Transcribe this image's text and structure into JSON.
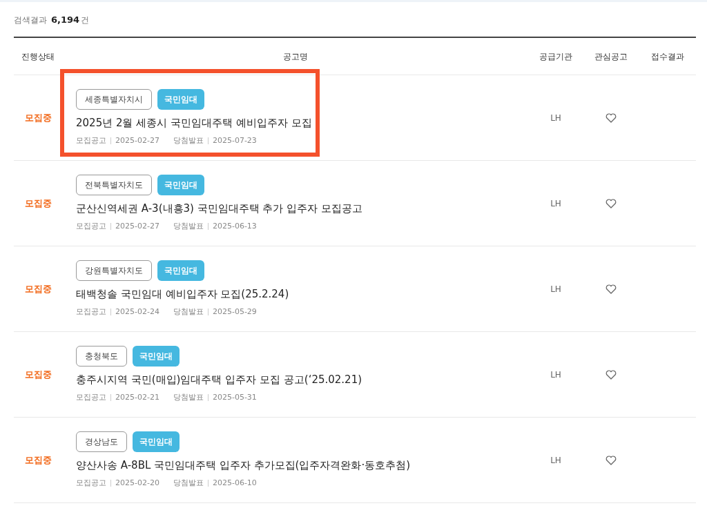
{
  "result_summary": {
    "label": "검색결과",
    "count": "6,194",
    "unit": "건"
  },
  "table": {
    "columns": [
      "진행상태",
      "공고명",
      "공급기관",
      "관심공고",
      "접수결과"
    ],
    "rows": [
      {
        "status": "모집중",
        "region": "세종특별자치시",
        "type": "국민임대",
        "title": "2025년 2월 세종시 국민임대주택 예비입주자 모집",
        "notice_label": "모집공고",
        "notice_date": "2025-02-27",
        "winner_label": "당첨발표",
        "winner_date": "2025-07-23",
        "supplier": "LH",
        "favorite": false,
        "highlighted": true
      },
      {
        "status": "모집중",
        "region": "전북특별자치도",
        "type": "국민임대",
        "title": "군산신역세권 A-3(내흥3) 국민임대주택 추가 입주자 모집공고",
        "notice_label": "모집공고",
        "notice_date": "2025-02-27",
        "winner_label": "당첨발표",
        "winner_date": "2025-06-13",
        "supplier": "LH",
        "favorite": false,
        "highlighted": false
      },
      {
        "status": "모집중",
        "region": "강원특별자치도",
        "type": "국민임대",
        "title": "태백청솔 국민임대 예비입주자 모집(25.2.24)",
        "notice_label": "모집공고",
        "notice_date": "2025-02-24",
        "winner_label": "당첨발표",
        "winner_date": "2025-05-29",
        "supplier": "LH",
        "favorite": false,
        "highlighted": false
      },
      {
        "status": "모집중",
        "region": "충청북도",
        "type": "국민임대",
        "title": "충주시지역 국민(매입)임대주택 입주자 모집 공고(‘25.02.21)",
        "notice_label": "모집공고",
        "notice_date": "2025-02-21",
        "winner_label": "당첨발표",
        "winner_date": "2025-05-31",
        "supplier": "LH",
        "favorite": false,
        "highlighted": false
      },
      {
        "status": "모집중",
        "region": "경상남도",
        "type": "국민임대",
        "title": "양산사송 A-8BL 국민임대주택 입주자 추가모집(입주자격완화·동호추첨)",
        "notice_label": "모집공고",
        "notice_date": "2025-02-20",
        "winner_label": "당첨발표",
        "winner_date": "2025-06-10",
        "supplier": "LH",
        "favorite": false,
        "highlighted": false
      }
    ]
  }
}
